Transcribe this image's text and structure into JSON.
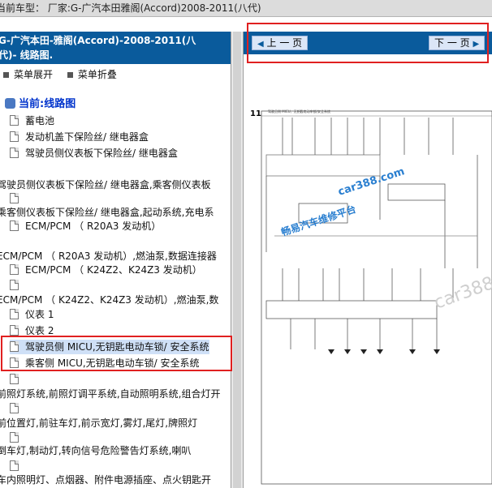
{
  "title_bar": {
    "text": "当前车型：   厂家:G-广汽本田雅阁(Accord)2008-2011(八代)"
  },
  "left_panel": {
    "header_line1": "G-广汽本田-雅阁(Accord)-2008-2011(八",
    "header_line2": "代)- 线路图.",
    "expand_label": "菜单展开",
    "collapse_label": "菜单折叠",
    "root_label": "当前:线路图",
    "items": [
      "蓄电池",
      "发动机盖下保险丝/ 继电器盒",
      "驾驶员侧仪表板下保险丝/ 继电器盒",
      "驾驶员侧仪表板下保险丝/ 继电器盒,乘客侧仪表板",
      "乘客侧仪表板下保险丝/ 继电器盒,起动系统,充电系",
      "ECM/PCM （ R20A3 发动机）",
      "ECM/PCM （ R20A3 发动机）,燃油泵,数据连接器",
      "ECM/PCM （ K24Z2、K24Z3 发动机）",
      "ECM/PCM （ K24Z2、K24Z3 发动机）,燃油泵,数",
      "仪表 1",
      "仪表 2",
      "驾驶员侧 MICU,无钥匙电动车锁/ 安全系统",
      "乘客侧 MICU,无钥匙电动车锁/ 安全系统",
      "前照灯系统,前照灯调平系统,自动照明系统,组合灯开",
      "前位置灯,前驻车灯,前示宽灯,雾灯,尾灯,牌照灯",
      "倒车灯,制动灯,转向信号危险警告灯系统,喇叭",
      "车内照明灯、点烟器、附件电源插座、点火钥匙开"
    ]
  },
  "right_panel": {
    "prev_label": "上 一 页",
    "next_label": "下 一 页",
    "page_number": "11",
    "diagram_caption": "驾驶员侧 MICU、无钥匙电动车锁/安全系统",
    "watermark_url": "car388.com",
    "watermark_name": "畅易汽车维修平台"
  },
  "colors": {
    "header_blue": "#0a5b9c",
    "annotation_red": "#e02020",
    "watermark_blue": "#2a7fd0"
  }
}
